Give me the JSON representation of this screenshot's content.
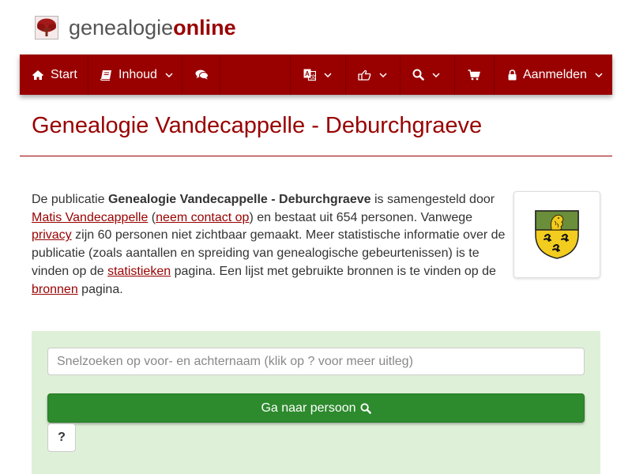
{
  "brand": {
    "name_part1": "genealogie",
    "name_part2": "online",
    "logo_icon": "tree-logo-icon"
  },
  "nav": {
    "start_label": "Start",
    "inhoud_label": "Inhoud",
    "login_label": "Aanmelden",
    "icons": [
      "home-icon",
      "book-icon",
      "chat-icon",
      "language-icon",
      "share-icon",
      "search-icon",
      "cart-icon",
      "lock-icon"
    ]
  },
  "page": {
    "title": "Genealogie Vandecappelle - Deburchgraeve"
  },
  "intro": {
    "t1": "De publicatie ",
    "publication": "Genealogie Vandecappelle - Deburchgraeve",
    "t2": " is samengesteld door ",
    "author": "Matis Vandecappelle",
    "t3": " (",
    "contact": "neem contact op",
    "t4": ") en bestaat uit 654 personen. Vanwege ",
    "privacy": "privacy",
    "t5": " zijn 60 personen niet zichtbaar gemaakt. Meer statistische informatie over de publicatie (zoals aantallen en spreiding van genealogische gebeurtenissen) is te vinden op de ",
    "stats": "statistieken",
    "t6": " pagina. Een lijst met gebruikte bronnen is te vinden op de ",
    "sources": "bronnen",
    "t7": " pagina."
  },
  "search": {
    "placeholder": "Snelzoeken op voor- en achternaam (klik op ? voor meer uitleg)",
    "button_label": "Ga naar persoon",
    "help_label": "?"
  },
  "colors": {
    "brand_red": "#990000",
    "panel_green": "#dff0d8",
    "button_green": "#2d8a2d",
    "shield_top": "#6b8e3a",
    "shield_bottom": "#f2cc1f"
  }
}
